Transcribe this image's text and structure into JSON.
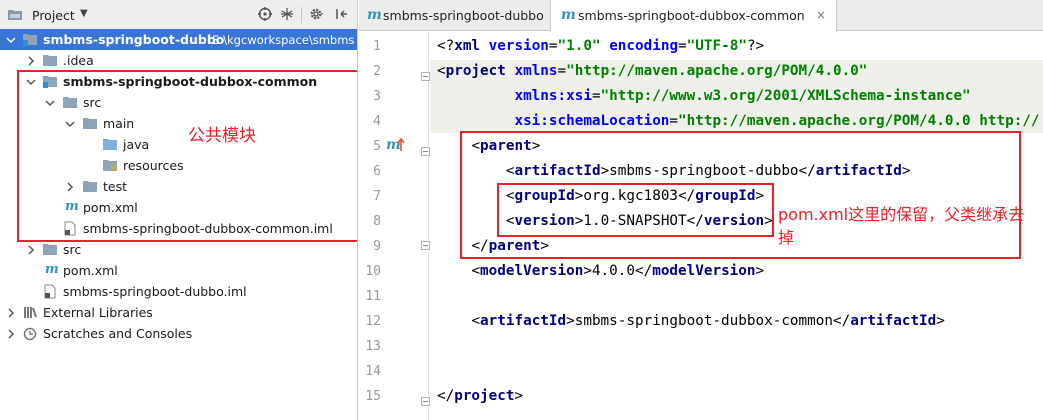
{
  "project_panel": {
    "title": "Project",
    "dropdown_icon": "triangle-down-icon",
    "header_icons": [
      "crosshair-target-icon",
      "collapse-all-icon",
      "gear-icon",
      "hide-panel-icon"
    ],
    "tree": [
      {
        "label": "smbms-springboot-dubbo",
        "path": "E:\\kgcworkspace\\smbms",
        "icon": "module-folder-icon",
        "expanded": true,
        "selected": true,
        "bold": true
      },
      {
        "label": ".idea",
        "icon": "folder-icon",
        "expanded": false
      },
      {
        "label": "smbms-springboot-dubbox-common",
        "icon": "module-folder-icon",
        "expanded": true,
        "bold": true
      },
      {
        "label": "src",
        "icon": "folder-icon",
        "expanded": true
      },
      {
        "label": "main",
        "icon": "folder-icon",
        "expanded": true
      },
      {
        "label": "java",
        "icon": "source-folder-icon"
      },
      {
        "label": "resources",
        "icon": "resources-folder-icon"
      },
      {
        "label": "test",
        "icon": "folder-icon",
        "expanded": false
      },
      {
        "label": "pom.xml",
        "icon": "maven-icon"
      },
      {
        "label": "smbms-springboot-dubbox-common.iml",
        "icon": "iml-file-icon"
      },
      {
        "label": "src",
        "icon": "folder-icon",
        "expanded": false
      },
      {
        "label": "pom.xml",
        "icon": "maven-icon"
      },
      {
        "label": "smbms-springboot-dubbo.iml",
        "icon": "iml-file-icon"
      },
      {
        "label": "External Libraries",
        "icon": "libraries-icon",
        "expanded": false
      },
      {
        "label": "Scratches and Consoles",
        "icon": "scratches-icon",
        "expanded": false
      }
    ]
  },
  "annotations": {
    "left_note": "公共模块",
    "right_note": "pom.xml这里的保留，父类继承去掉",
    "color": "#e8202a"
  },
  "editor": {
    "tabs": [
      {
        "label": "smbms-springboot-dubbo",
        "icon": "maven-icon",
        "active": false
      },
      {
        "label": "smbms-springboot-dubbox-common",
        "icon": "maven-icon",
        "active": true,
        "close": "×"
      }
    ],
    "line_numbers": [
      "1",
      "2",
      "3",
      "4",
      "5",
      "6",
      "7",
      "8",
      "9",
      "10",
      "11",
      "12",
      "13",
      "14",
      "15"
    ],
    "override_marker": "override-arrow-icon",
    "lines": {
      "l1": {
        "open": "<?",
        "name": "xml",
        "attr1": "version",
        "eq1": "=",
        "val1": "\"1.0\"",
        "attr2": "encoding",
        "eq2": "=",
        "val2": "\"UTF-8\"",
        "close": "?>"
      },
      "l2": {
        "open": "<",
        "name": "project",
        "attr": "xmlns",
        "eq": "=",
        "val": "\"http://maven.apache.org/POM/4.0.0\""
      },
      "l3": {
        "attr": "xmlns:xsi",
        "eq": "=",
        "val": "\"http://www.w3.org/2001/XMLSchema-instance\""
      },
      "l4": {
        "attr": "xsi:schemaLocation",
        "eq": "=",
        "val": "\"http://maven.apache.org/POM/4.0.0 http://"
      },
      "l5": {
        "open": "<",
        "name": "parent",
        "close": ">"
      },
      "l6": {
        "open": "<",
        "name": "artifactId",
        "close": ">",
        "text": "smbms-springboot-dubbo",
        "end_open": "</",
        "end_close": ">"
      },
      "l7": {
        "open": "<",
        "name": "groupId",
        "close": ">",
        "text": "org.kgc1803",
        "end_open": "</",
        "end_close": ">"
      },
      "l8": {
        "open": "<",
        "name": "version",
        "close": ">",
        "text": "1.0-SNAPSHOT",
        "end_open": "</",
        "end_close": ">"
      },
      "l9": {
        "open": "</",
        "name": "parent",
        "close": ">"
      },
      "l10": {
        "open": "<",
        "name": "modelVersion",
        "close": ">",
        "text": "4.0.0",
        "end_open": "</",
        "end_close": ">"
      },
      "l12": {
        "open": "<",
        "name": "artifactId",
        "close": ">",
        "text": "smbms-springboot-dubbox-common",
        "end_open": "</",
        "end_close": ">"
      },
      "l15": {
        "open": "</",
        "name": "project",
        "close": ">"
      }
    }
  }
}
